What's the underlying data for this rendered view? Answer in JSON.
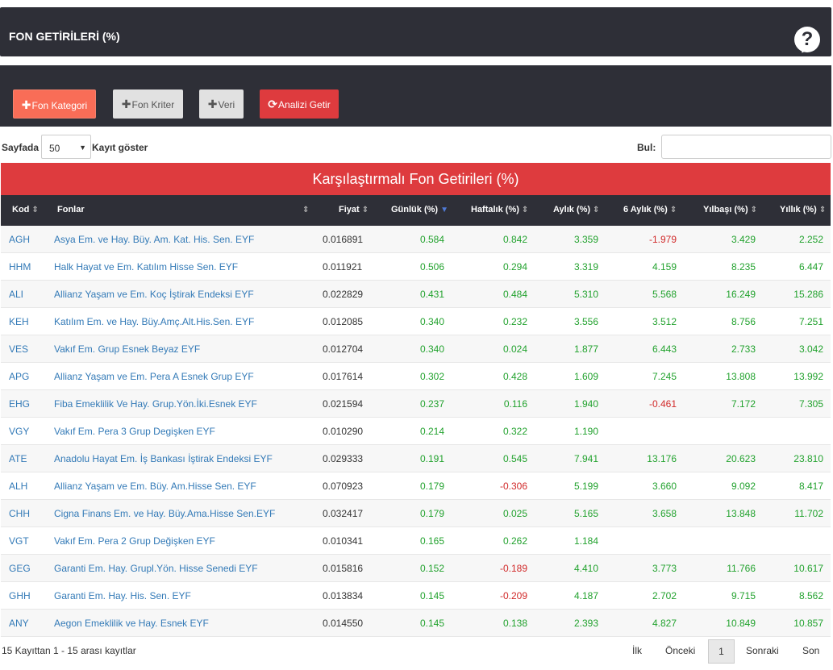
{
  "header": {
    "title": "FON GETİRİLERİ (%)",
    "help_glyph": "?"
  },
  "filters": {
    "category_label": "Fon Kategori",
    "criteria_label": "Fon Kriter",
    "data_label": "Veri",
    "analyze_label": "Analizi Getir"
  },
  "length": {
    "before": "Sayfada",
    "value": "50",
    "after": "Kayıt göster"
  },
  "search": {
    "label": "Bul:",
    "value": ""
  },
  "table": {
    "title": "Karşılaştırmalı Fon Getirileri (%)",
    "columns": [
      "Kod",
      "Fonlar",
      "Fiyat",
      "Günlük (%)",
      "Haftalık (%)",
      "Aylık (%)",
      "6 Aylık (%)",
      "Yılbaşı (%)",
      "Yıllık (%)"
    ],
    "rows": [
      [
        "AGH",
        "Asya Em. ve Hay. Büy. Am. Kat. His. Sen. EYF",
        "0.016891",
        "0.584",
        "0.842",
        "3.359",
        "-1.979",
        "3.429",
        "2.252"
      ],
      [
        "HHM",
        "Halk Hayat ve Em. Katılım Hisse Sen. EYF",
        "0.011921",
        "0.506",
        "0.294",
        "3.319",
        "4.159",
        "8.235",
        "6.447"
      ],
      [
        "ALI",
        "Allianz Yaşam ve Em. Koç İştirak Endeksi EYF",
        "0.022829",
        "0.431",
        "0.484",
        "5.310",
        "5.568",
        "16.249",
        "15.286"
      ],
      [
        "KEH",
        "Katılım Em. ve Hay. Büy.Amç.Alt.His.Sen. EYF",
        "0.012085",
        "0.340",
        "0.232",
        "3.556",
        "3.512",
        "8.756",
        "7.251"
      ],
      [
        "VES",
        "Vakıf Em. Grup Esnek Beyaz EYF",
        "0.012704",
        "0.340",
        "0.024",
        "1.877",
        "6.443",
        "2.733",
        "3.042"
      ],
      [
        "APG",
        "Allianz Yaşam ve Em. Pera A Esnek Grup EYF",
        "0.017614",
        "0.302",
        "0.428",
        "1.609",
        "7.245",
        "13.808",
        "13.992"
      ],
      [
        "EHG",
        "Fiba Emeklilik Ve Hay. Grup.Yön.İki.Esnek EYF",
        "0.021594",
        "0.237",
        "0.116",
        "1.940",
        "-0.461",
        "7.172",
        "7.305"
      ],
      [
        "VGY",
        "Vakıf Em. Pera 3 Grup Degişken EYF",
        "0.010290",
        "0.214",
        "0.322",
        "1.190",
        "",
        "",
        ""
      ],
      [
        "ATE",
        "Anadolu Hayat Em. İş Bankası İştirak Endeksi EYF",
        "0.029333",
        "0.191",
        "0.545",
        "7.941",
        "13.176",
        "20.623",
        "23.810"
      ],
      [
        "ALH",
        "Allianz Yaşam ve Em. Büy. Am.Hisse Sen. EYF",
        "0.070923",
        "0.179",
        "-0.306",
        "5.199",
        "3.660",
        "9.092",
        "8.417"
      ],
      [
        "CHH",
        "Cigna Finans Em. ve Hay. Büy.Ama.Hisse Sen.EYF",
        "0.032417",
        "0.179",
        "0.025",
        "5.165",
        "3.658",
        "13.848",
        "11.702"
      ],
      [
        "VGT",
        "Vakıf Em. Pera 2 Grup Değişken EYF",
        "0.010341",
        "0.165",
        "0.262",
        "1.184",
        "",
        "",
        ""
      ],
      [
        "GEG",
        "Garanti Em. Hay. Grupl.Yön. Hisse Senedi EYF",
        "0.015816",
        "0.152",
        "-0.189",
        "4.410",
        "3.773",
        "11.766",
        "10.617"
      ],
      [
        "GHH",
        "Garanti Em. Hay. His. Sen. EYF",
        "0.013834",
        "0.145",
        "-0.209",
        "4.187",
        "2.702",
        "9.715",
        "8.562"
      ],
      [
        "ANY",
        "Aegon Emeklilik ve Hay. Esnek EYF",
        "0.014550",
        "0.145",
        "0.138",
        "2.393",
        "4.827",
        "10.849",
        "10.857"
      ]
    ]
  },
  "footer": {
    "info": "15 Kayıttan 1 - 15 arası kayıtlar",
    "first": "İlk",
    "prev": "Önceki",
    "page": "1",
    "next": "Sonraki",
    "last": "Son"
  },
  "colors": {
    "positive": "#22a22e",
    "negative": "#d12a2a",
    "accent": "#de3b3e",
    "dark": "#2e2f37"
  }
}
